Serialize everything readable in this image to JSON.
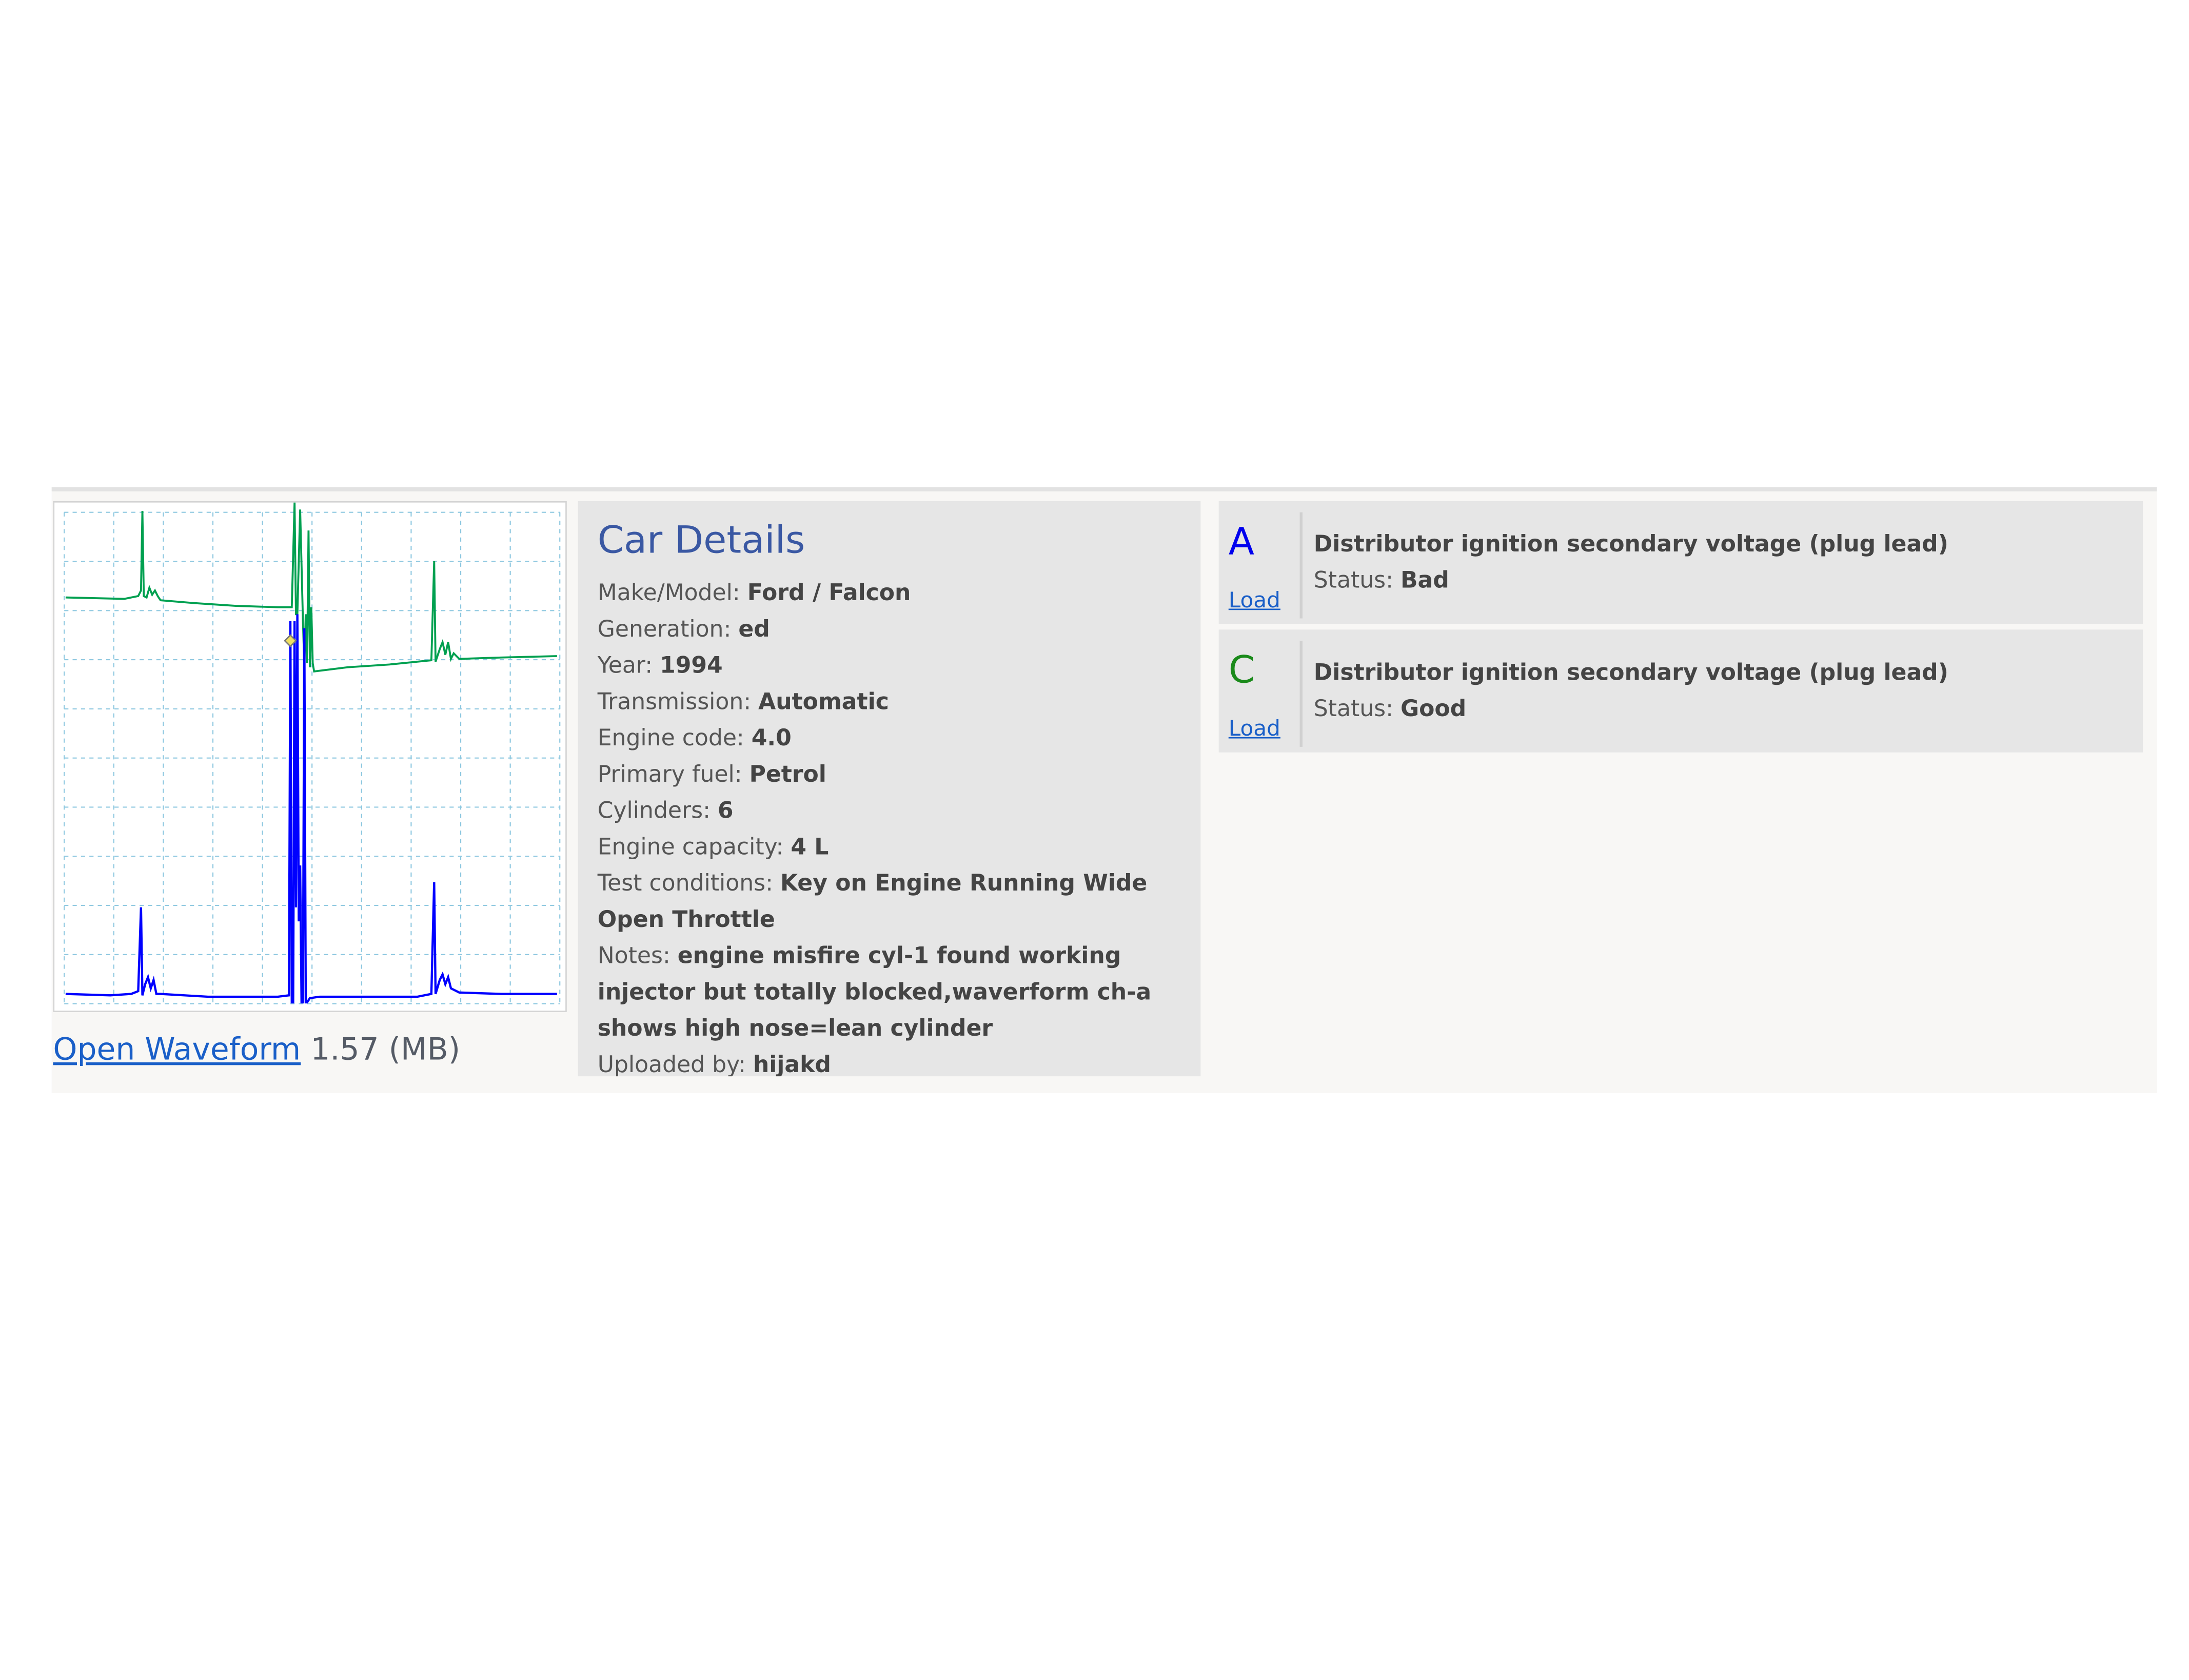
{
  "waveform": {
    "open_link": "Open Waveform",
    "file_size": "1.57 (MB)",
    "colors": {
      "channel_a": "#0000ff",
      "channel_c": "#00a050",
      "grid": "#8ec8e0"
    }
  },
  "car_details": {
    "heading": "Car Details",
    "rows": [
      {
        "label": "Make/Model: ",
        "value": "Ford / Falcon"
      },
      {
        "label": "Generation: ",
        "value": "ed"
      },
      {
        "label": "Year: ",
        "value": "1994"
      },
      {
        "label": "Transmission: ",
        "value": "Automatic"
      },
      {
        "label": "Engine code: ",
        "value": "4.0"
      },
      {
        "label": "Primary fuel: ",
        "value": "Petrol"
      },
      {
        "label": "Cylinders: ",
        "value": "6"
      },
      {
        "label": "Engine capacity: ",
        "value": "4 L"
      },
      {
        "label": "Test conditions: ",
        "value": "Key on Engine Running Wide Open Throttle"
      },
      {
        "label": "Notes: ",
        "value": "engine misfire cyl-1 found working injector but totally blocked,waverform ch-a shows high nose=lean cylinder"
      },
      {
        "label": "Uploaded by: ",
        "value": "hijakd"
      }
    ]
  },
  "results": [
    {
      "channel": "A",
      "channel_color": "#0000ee",
      "load_label": "Load",
      "title": "Distributor ignition secondary voltage (plug lead)",
      "status_label": "Status: ",
      "status_value": "Bad"
    },
    {
      "channel": "C",
      "channel_color": "#1a8a1a",
      "load_label": "Load",
      "title": "Distributor ignition secondary voltage (plug lead)",
      "status_label": "Status: ",
      "status_value": "Good"
    }
  ]
}
